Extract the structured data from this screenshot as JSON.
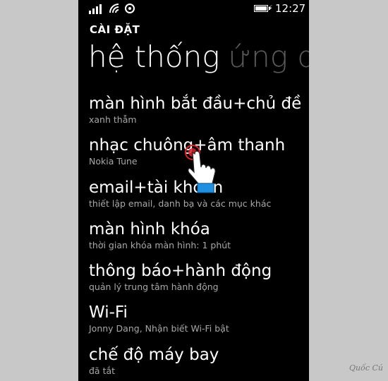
{
  "status": {
    "time": "12:27"
  },
  "app_title": "CÀI ĐẶT",
  "pivot": {
    "active": "hệ thống",
    "next": "ứng d"
  },
  "settings": [
    {
      "title": "màn hình bắt đầu+chủ đề",
      "subtitle": "xanh thẫm"
    },
    {
      "title": "nhạc chuông+âm thanh",
      "subtitle": "Nokia Tune"
    },
    {
      "title": "email+tài khoản",
      "subtitle": "thiết lập email, danh bạ và các mục khác"
    },
    {
      "title": "màn hình khóa",
      "subtitle": "thời gian khóa màn hình: 1 phút"
    },
    {
      "title": "thông báo+hành động",
      "subtitle": "quản lý trung tâm hành động"
    },
    {
      "title": "Wi-Fi",
      "subtitle": "Jonny Dang, Nhận biết Wi-Fi bật"
    },
    {
      "title": "chế độ máy bay",
      "subtitle": "đã tắt"
    }
  ],
  "watermark": "Quốc Cú",
  "colors": {
    "background": "#000000",
    "subtitle": "#a8a8a8",
    "inactive_pivot": "#5a5a5a",
    "touch_red": "#e0202a",
    "cuff_blue": "#1f8fe0"
  }
}
